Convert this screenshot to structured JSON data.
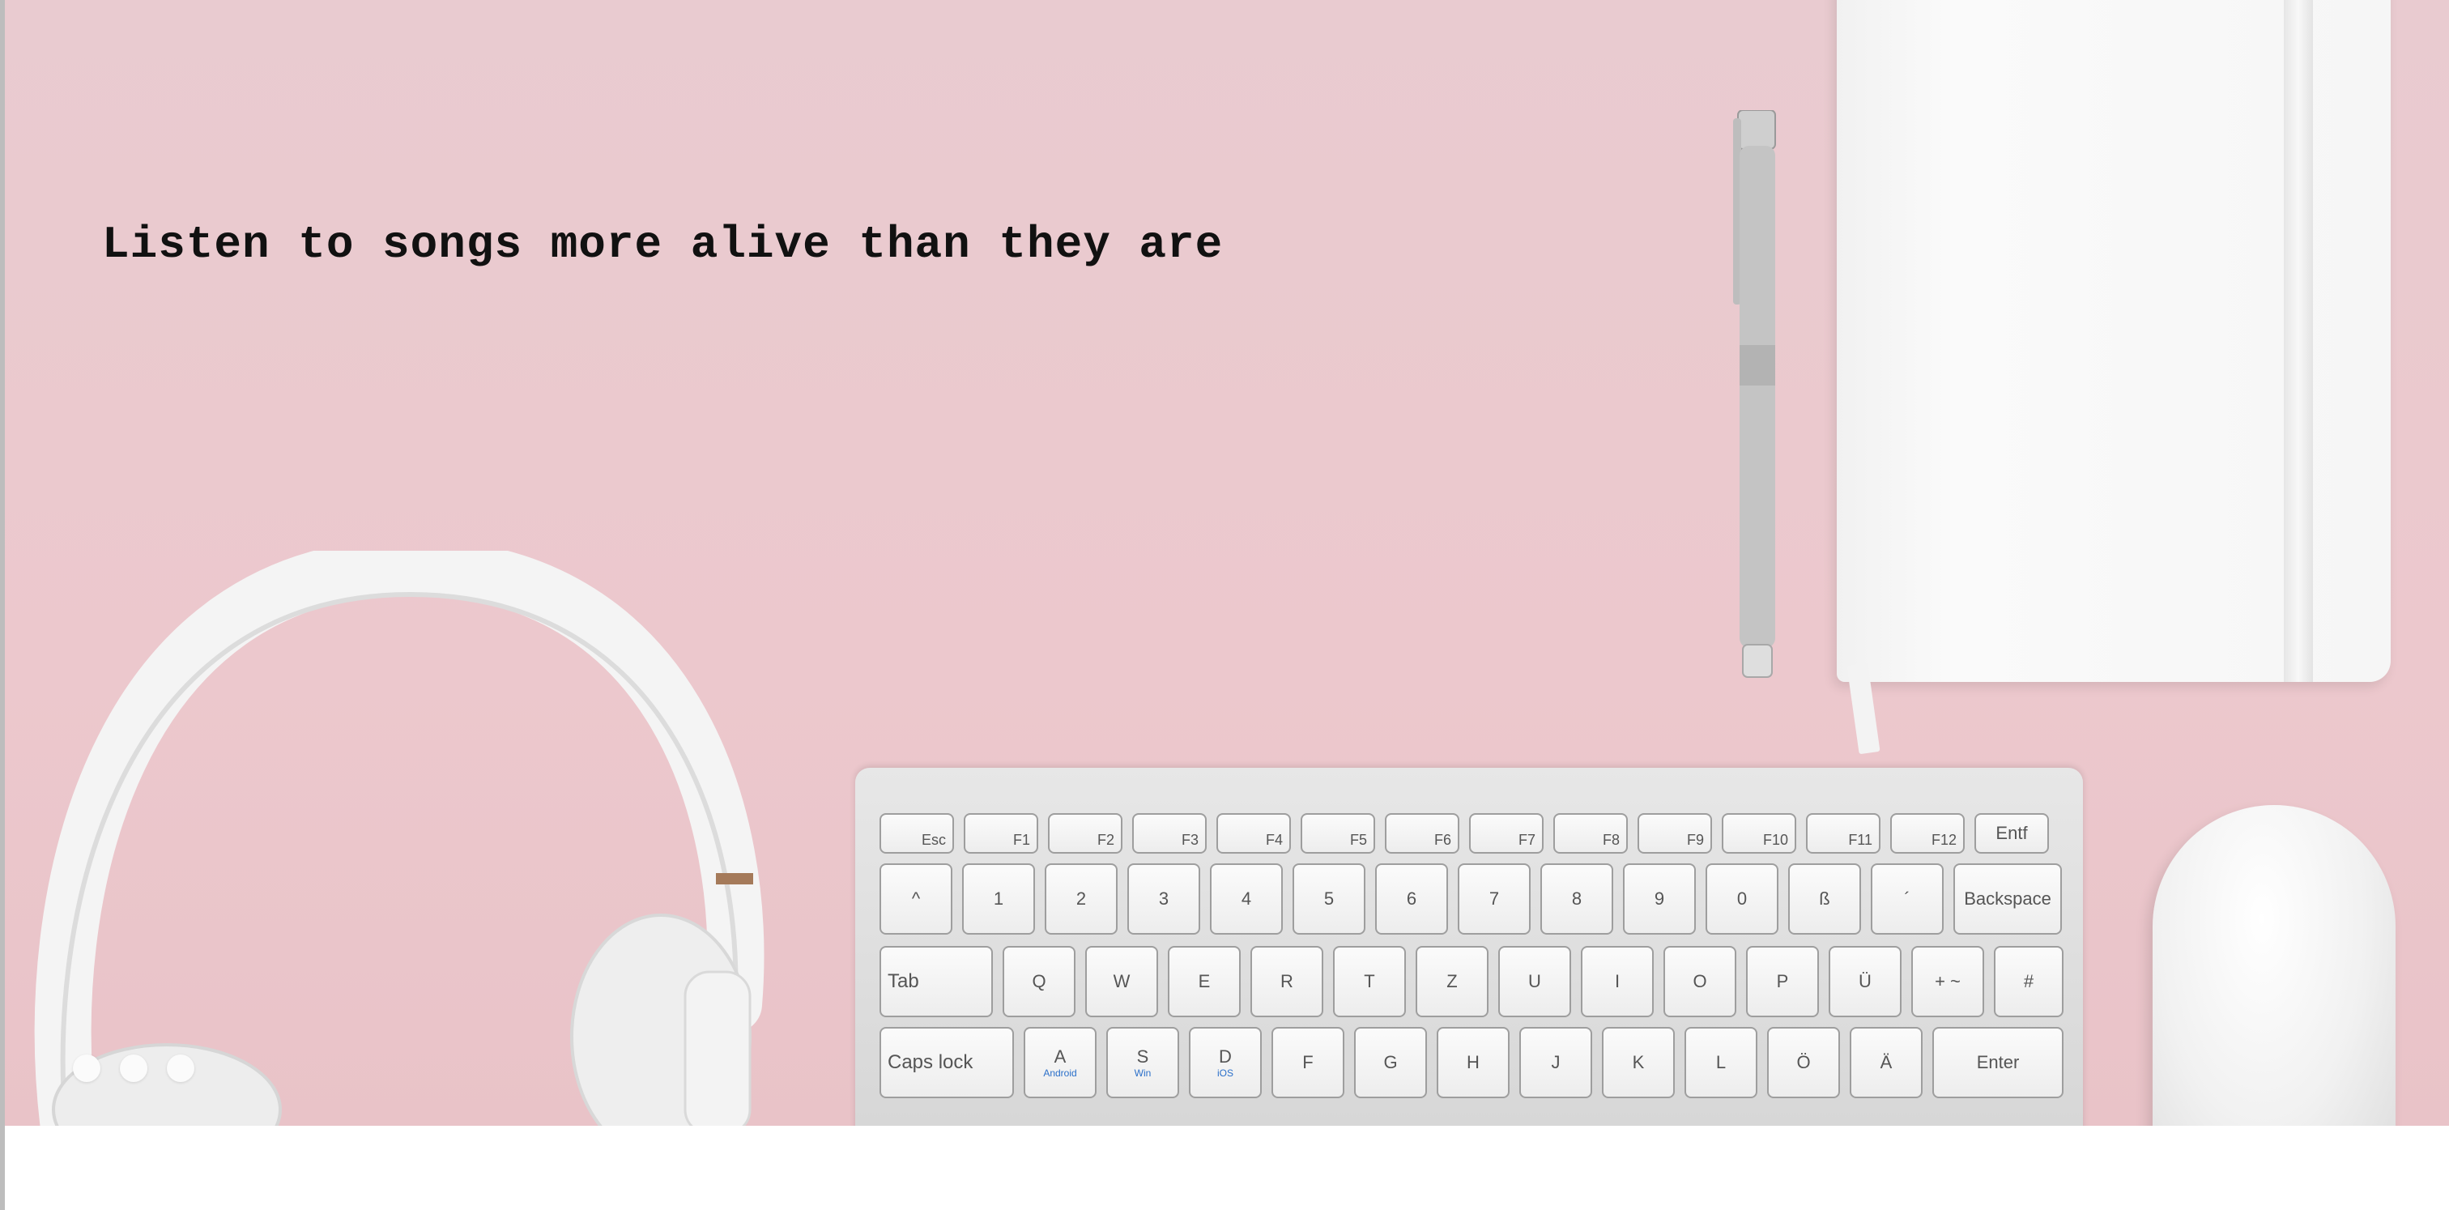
{
  "hero": {
    "title": "Listen to songs more alive than they are",
    "background_color": "#e9c8cd",
    "carousel_dots": 3
  },
  "keyboard": {
    "function_row": [
      "Esc",
      "F1",
      "F2",
      "F3",
      "F4",
      "F5",
      "F6",
      "F7",
      "F8",
      "F9",
      "F10",
      "F11",
      "F12",
      "Entf"
    ],
    "number_row": [
      "^",
      "1",
      "2",
      "3",
      "4",
      "5",
      "6",
      "7",
      "8",
      "9",
      "0",
      "ß",
      "´",
      "Backspace"
    ],
    "top_row": [
      "Tab",
      "Q",
      "W",
      "E",
      "R",
      "T",
      "Z",
      "U",
      "I",
      "O",
      "P",
      "Ü",
      "+ ~",
      "#"
    ],
    "home_row": [
      "Caps lock",
      "A",
      "S",
      "D",
      "F",
      "G",
      "H",
      "J",
      "K",
      "L",
      "Ö",
      "Ä",
      "Enter"
    ],
    "home_row_sublabels": [
      "Android",
      "Win",
      "iOS"
    ]
  }
}
